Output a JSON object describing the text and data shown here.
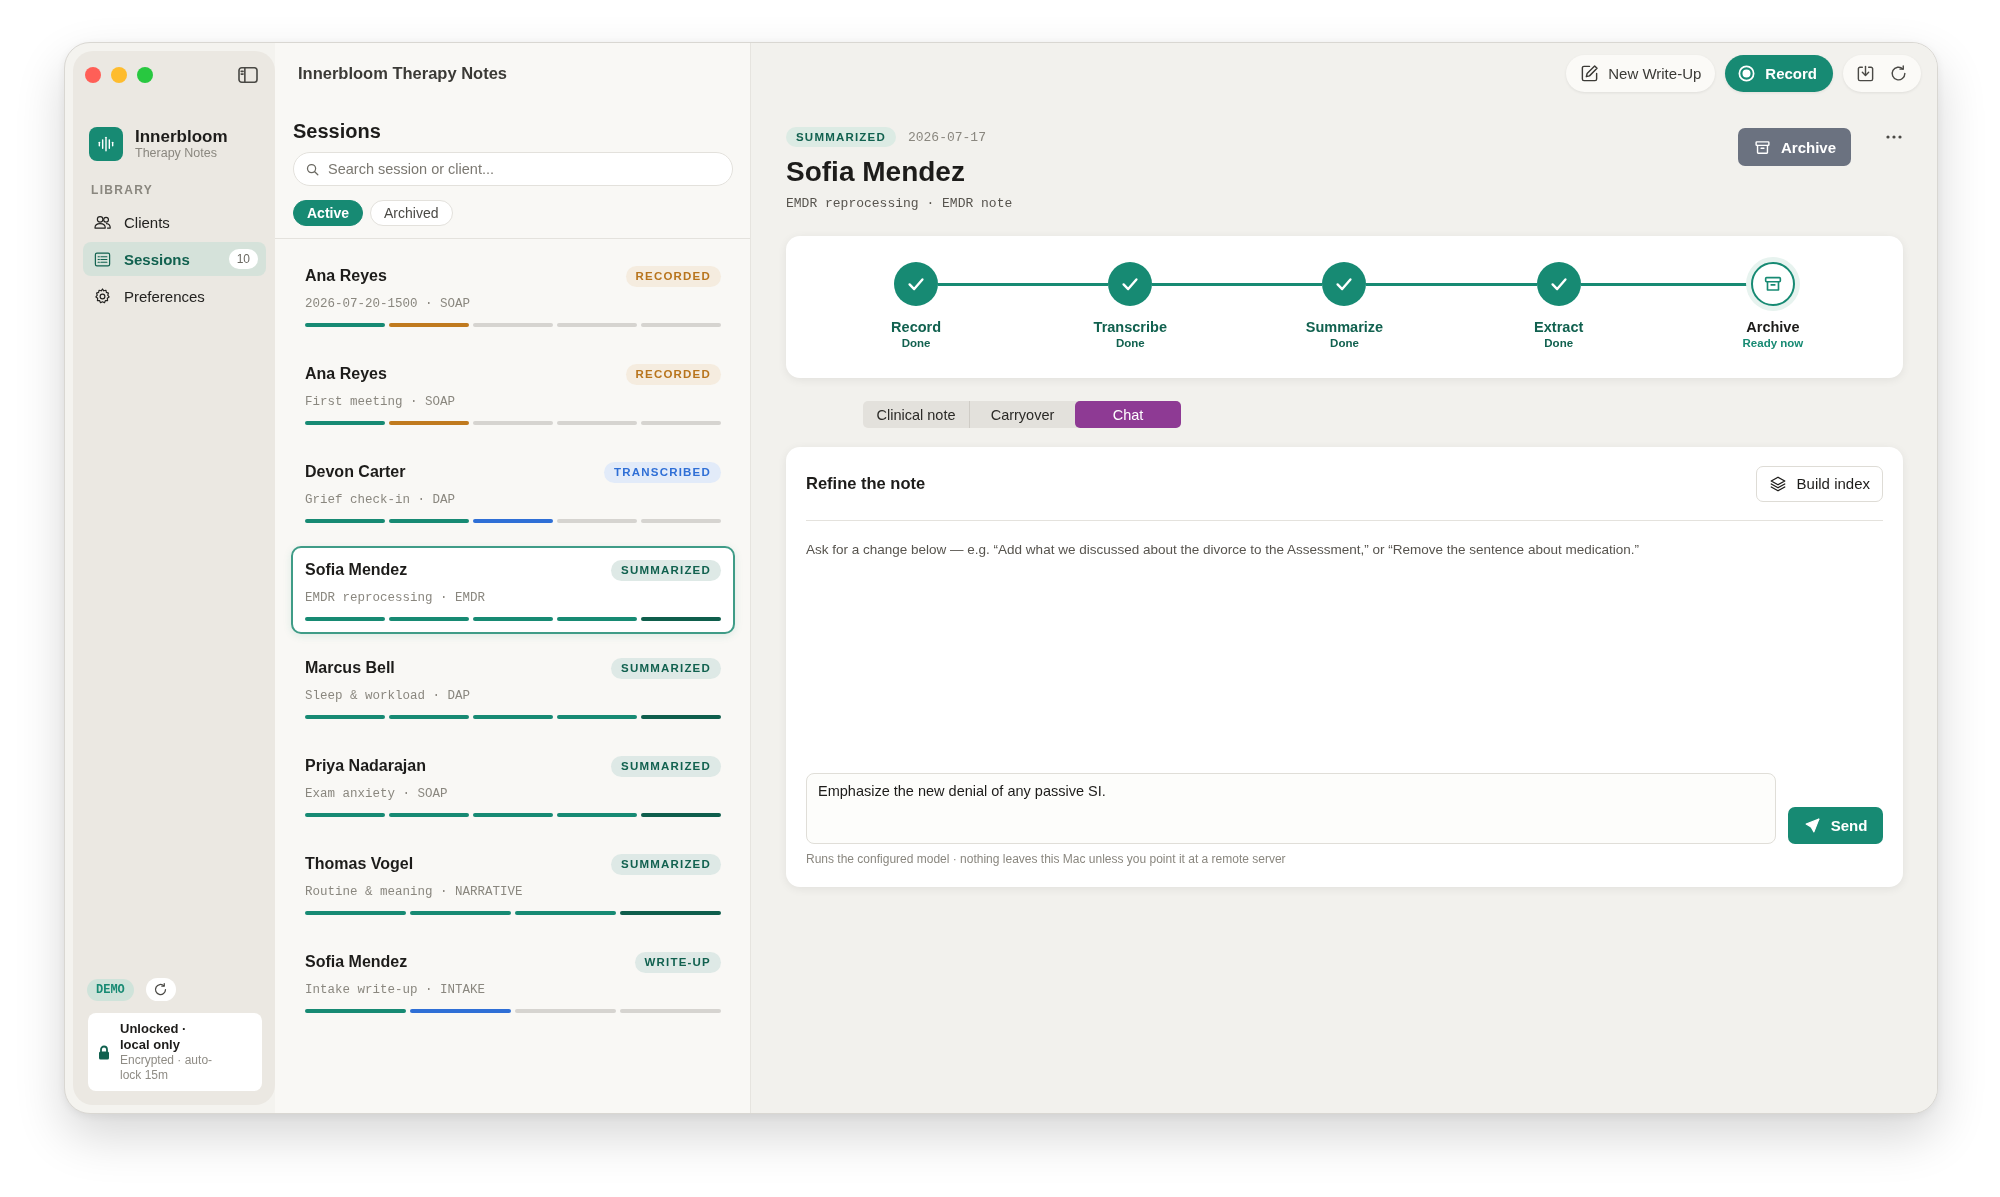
{
  "window": {
    "title": "Innerbloom Therapy Notes"
  },
  "sidebar": {
    "brand": {
      "name": "Innerbloom",
      "subtitle": "Therapy Notes"
    },
    "section": "LIBRARY",
    "items": [
      {
        "label": "Clients",
        "selected": false
      },
      {
        "label": "Sessions",
        "selected": true,
        "count": "10"
      },
      {
        "label": "Preferences",
        "selected": false
      }
    ],
    "demo_badge": "DEMO",
    "lock": {
      "title": "Unlocked · local only",
      "detail": "Encrypted · auto-lock 15m"
    }
  },
  "sessions": {
    "title": "Sessions",
    "search": {
      "placeholder": "Search session or client..."
    },
    "filters": [
      {
        "label": "Active",
        "selected": true
      },
      {
        "label": "Archived",
        "selected": false
      }
    ],
    "items": [
      {
        "name": "Ana Reyes",
        "status": "RECORDED",
        "color": "#b8741c",
        "subtitle": "2026-07-20-1500 · SOAP",
        "selected": false,
        "steps": [
          {
            "color": "#178a73"
          },
          {
            "color": "#c07a1e"
          },
          {
            "color": "#d6d4d0"
          },
          {
            "color": "#d6d4d0"
          },
          {
            "color": "#d6d4d0"
          }
        ]
      },
      {
        "name": "Ana Reyes",
        "status": "RECORDED",
        "color": "#b8741c",
        "subtitle": "First meeting · SOAP",
        "selected": false,
        "steps": [
          {
            "color": "#178a73"
          },
          {
            "color": "#c07a1e"
          },
          {
            "color": "#d6d4d0"
          },
          {
            "color": "#d6d4d0"
          },
          {
            "color": "#d6d4d0"
          }
        ]
      },
      {
        "name": "Devon Carter",
        "status": "TRANSCRIBED",
        "color": "#2f6fd6",
        "subtitle": "Grief check-in · DAP",
        "selected": false,
        "steps": [
          {
            "color": "#178a73"
          },
          {
            "color": "#178a73"
          },
          {
            "color": "#2f6fd6"
          },
          {
            "color": "#d6d4d0"
          },
          {
            "color": "#d6d4d0"
          }
        ]
      },
      {
        "name": "Sofia Mendez",
        "status": "SUMMARIZED",
        "color": "#11614f",
        "subtitle": "EMDR reprocessing · EMDR",
        "selected": true,
        "steps": [
          {
            "color": "#178a73"
          },
          {
            "color": "#178a73"
          },
          {
            "color": "#178a73"
          },
          {
            "color": "#178a73"
          },
          {
            "color": "#0f5e4c"
          }
        ]
      },
      {
        "name": "Marcus Bell",
        "status": "SUMMARIZED",
        "color": "#11614f",
        "subtitle": "Sleep & workload · DAP",
        "selected": false,
        "steps": [
          {
            "color": "#178a73"
          },
          {
            "color": "#178a73"
          },
          {
            "color": "#178a73"
          },
          {
            "color": "#178a73"
          },
          {
            "color": "#0f5e4c"
          }
        ]
      },
      {
        "name": "Priya Nadarajan",
        "status": "SUMMARIZED",
        "color": "#11614f",
        "subtitle": "Exam anxiety · SOAP",
        "selected": false,
        "steps": [
          {
            "color": "#178a73"
          },
          {
            "color": "#178a73"
          },
          {
            "color": "#178a73"
          },
          {
            "color": "#178a73"
          },
          {
            "color": "#0f5e4c"
          }
        ]
      },
      {
        "name": "Thomas Vogel",
        "status": "SUMMARIZED",
        "color": "#11614f",
        "subtitle": "Routine & meaning · NARRATIVE",
        "selected": false,
        "steps": [
          {
            "color": "#178a73"
          },
          {
            "color": "#178a73"
          },
          {
            "color": "#178a73"
          },
          {
            "color": "#0f5e4c"
          }
        ]
      },
      {
        "name": "Sofia Mendez",
        "status": "WRITE-UP",
        "color": "#11614f",
        "subtitle": "Intake write-up · INTAKE",
        "selected": false,
        "steps": [
          {
            "color": "#178a73"
          },
          {
            "color": "#2f6fd6"
          },
          {
            "color": "#d6d4d0"
          },
          {
            "color": "#d6d4d0"
          }
        ]
      }
    ]
  },
  "detail": {
    "toolbar": [
      {
        "label": "New Write-Up",
        "kind": "secondary"
      },
      {
        "label": "Record",
        "kind": "primary"
      }
    ],
    "status": "SUMMARIZED",
    "date": "2026-07-17",
    "name": "Sofia Mendez",
    "subtitle": "EMDR reprocessing · EMDR note",
    "archive_button": "Archive",
    "steps": [
      {
        "label": "Record",
        "status": "Done",
        "done": true
      },
      {
        "label": "Transcribe",
        "status": "Done",
        "done": true
      },
      {
        "label": "Summarize",
        "status": "Done",
        "done": true
      },
      {
        "label": "Extract",
        "status": "Done",
        "done": true
      },
      {
        "label": "Archive",
        "status": "Ready now",
        "done": false
      }
    ],
    "tabs": [
      {
        "label": "Clinical note",
        "selected": false
      },
      {
        "label": "Carryover",
        "selected": false
      },
      {
        "label": "Chat",
        "selected": true
      }
    ],
    "chat": {
      "title": "Refine the note",
      "build_button": "Build index",
      "hint": "Ask for a change below — e.g. “Add what we discussed about the divorce to the Assessment,” or “Remove the sentence about medication.”",
      "input": {
        "value": "Emphasize the new denial of any passive SI."
      },
      "send_button": "Send",
      "footnote": "Runs the configured model · nothing leaves this Mac unless you point it at a remote server"
    }
  }
}
